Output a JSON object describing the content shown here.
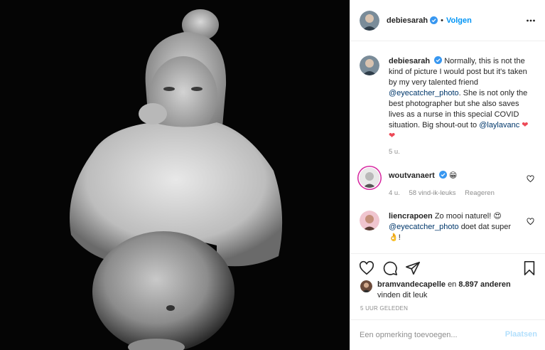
{
  "post": {
    "author": "debiesarah",
    "follow_label": "Volgen",
    "dot": "•",
    "caption_text": "Normally, this is not the kind of picture I would post but it's taken by my very talented friend",
    "mention_1": "@eyecatcher_photo",
    "caption_text_2": ". She is not only the best photographer but she also saves lives as a nurse in this special COVID situation. Big shout-out to",
    "mention_2": "@laylavanc",
    "caption_time": "5 u."
  },
  "comments": [
    {
      "user": "woutvanaert",
      "emoji": "😁",
      "time": "4 u.",
      "likes": "58 vind-ik-leuks",
      "reply": "Reageren"
    },
    {
      "user": "liencrapoen",
      "text_1": "Zo mooi naturel!",
      "emoji_1": "😍",
      "mention": "@eyecatcher_photo",
      "text_2": "doet dat super",
      "emoji_2": "👌",
      "text_3": "!"
    }
  ],
  "likes_info": {
    "user": "bramvandecapelle",
    "connector": "en",
    "others": "8.897 anderen",
    "line2": "vinden dit leuk"
  },
  "timestamp": "5 UUR GELEDEN",
  "comment_box": {
    "placeholder": "Een opmerking toevoegen...",
    "submit_label": "Plaatsen"
  },
  "icons": {
    "verified": "verified-badge-icon",
    "more": "more-options-icon",
    "like": "heart-icon",
    "comment": "comment-icon",
    "share": "share-icon",
    "save": "bookmark-icon",
    "caption_hearts": "red-heart-emoji"
  },
  "colors": {
    "accent": "#0095f6",
    "verified": "#3897f0",
    "heart": "#ed4956",
    "muted": "#8e8e8e",
    "mention": "#00376b"
  }
}
